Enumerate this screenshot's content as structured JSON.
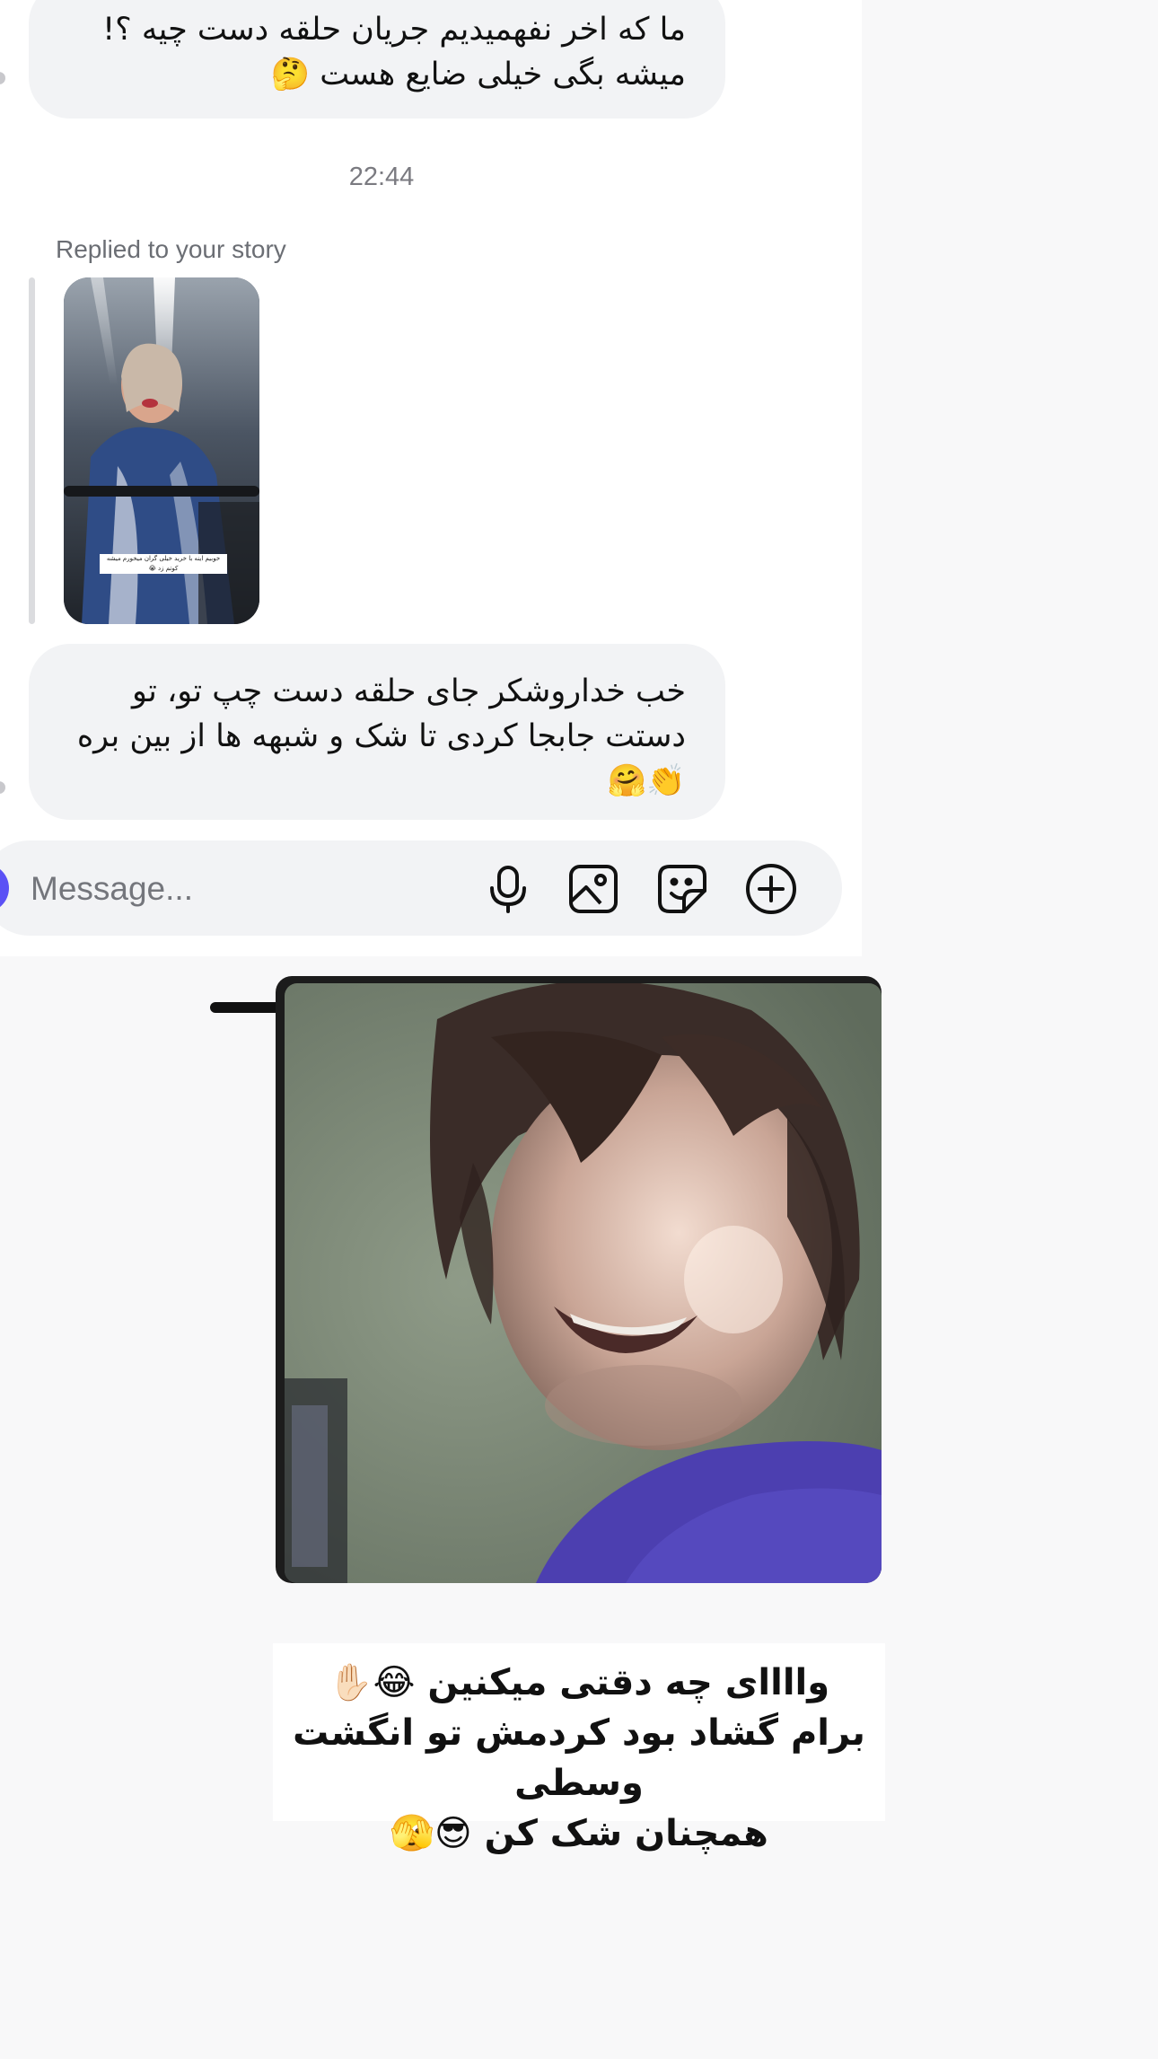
{
  "chat": {
    "message_1": {
      "line_1": "ما که اخر نفهمیدیم جریان حلقه دست چیه ؟!",
      "line_2": "میشه بگی خیلی ضایع هست 🤔"
    },
    "timestamp": "22:44",
    "replied_label": "Replied to your story",
    "story_caption": "خوبیم اینه با خرید خیلی گران میخورم میشه کوتم زد 😭",
    "message_2": {
      "line_1": "خب خداروشکر جای حلقه دست چپ تو، تو",
      "line_2": "دستت جابجا کردی تا شک و شبهه ها از بین بره",
      "line_3": "👏🤗"
    }
  },
  "composer": {
    "placeholder": "Message...",
    "icons": [
      "microphone-icon",
      "gallery-icon",
      "sticker-icon",
      "add-icon"
    ]
  },
  "overlay_caption": {
    "line_1": "واااای چه دقتی میکنین 😂✋🏻",
    "line_2": "برام گشاد بود کردمش تو انگشت وسطی",
    "line_3": "همچنان شک کن 😎🫣"
  },
  "colors": {
    "bubble": "#f2f3f5",
    "accent": "#5b51f5",
    "background": "#f8f8f9"
  }
}
